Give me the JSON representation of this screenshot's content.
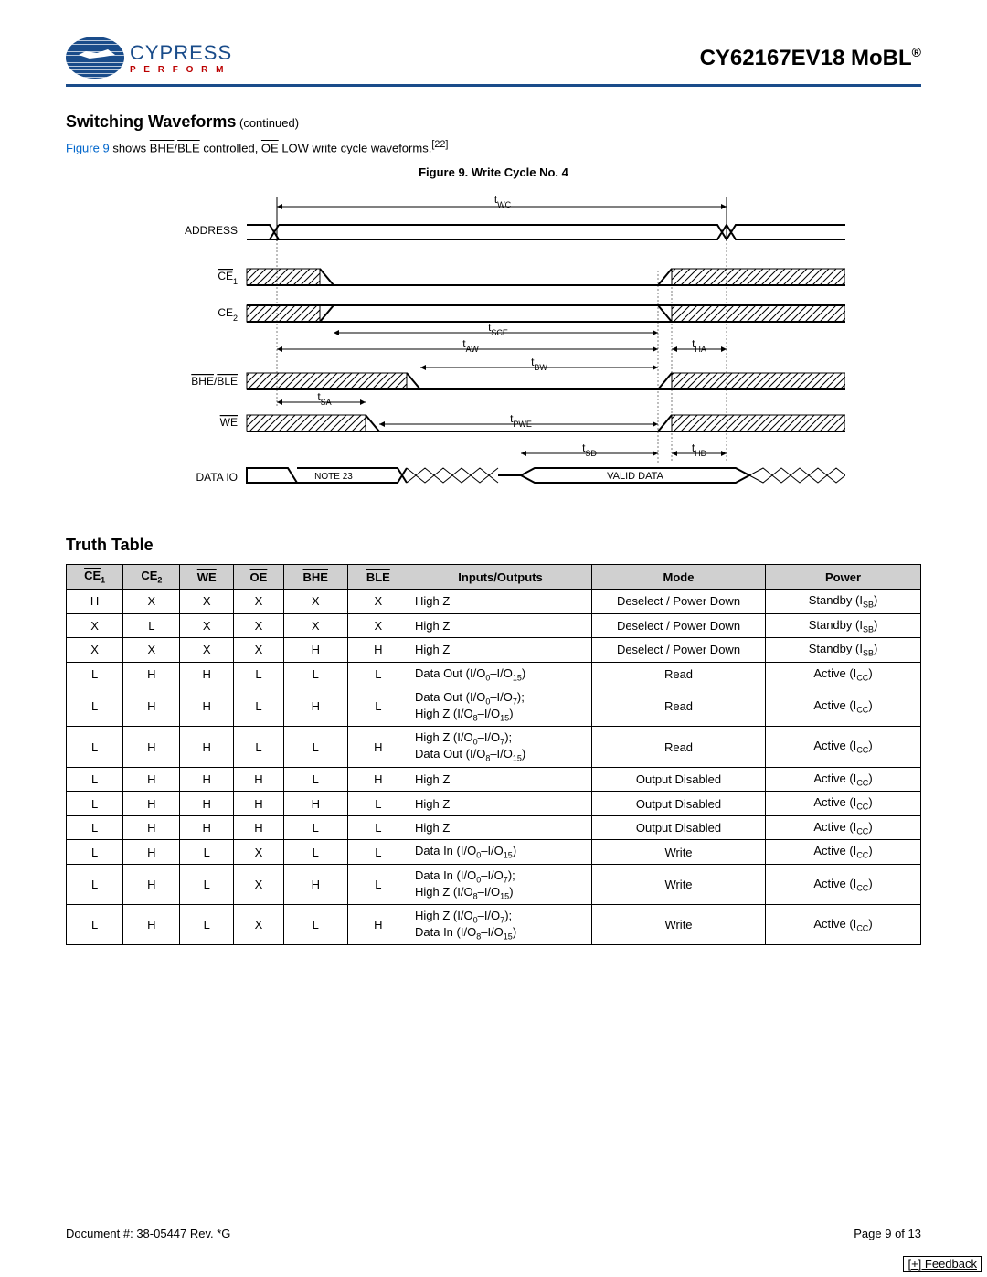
{
  "header": {
    "logo_name": "CYPRESS",
    "logo_perform": "P E R F O R M",
    "title": "CY62167EV18 MoBL",
    "title_sup": "®"
  },
  "section": {
    "heading": "Switching Waveforms",
    "continued": " (continued)",
    "intro_prefix": "Figure 9",
    "intro_rest_1": " shows ",
    "intro_bhe": "BHE",
    "intro_ble": "BLE",
    "intro_rest_2": " controlled, ",
    "intro_oe": "OE",
    "intro_rest_3": " LOW write cycle waveforms.",
    "intro_note": "[22]",
    "figure_caption": "Figure 9.  Write Cycle No. 4"
  },
  "waveform": {
    "signals": [
      "ADDRESS",
      "CE1",
      "CE2",
      "BHE/BLE",
      "WE",
      "DATA IO"
    ],
    "ce1_bar": true,
    "bhe_bar": true,
    "we_bar": true,
    "timing_labels": [
      "tWC",
      "tSCE",
      "tAW",
      "tHA",
      "tBW",
      "tSA",
      "tPWE",
      "tSD",
      "tHD"
    ],
    "note23": "NOTE 23",
    "valid_data": "VALID DATA"
  },
  "truth": {
    "title": "Truth Table",
    "headers": [
      "CE1",
      "CE2",
      "WE",
      "OE",
      "BHE",
      "BLE",
      "Inputs/Outputs",
      "Mode",
      "Power"
    ],
    "header_bars": [
      true,
      false,
      true,
      true,
      true,
      true,
      false,
      false,
      false
    ],
    "header_subs": [
      "1",
      "2",
      "",
      "",
      "",
      "",
      "",
      "",
      ""
    ],
    "rows": [
      {
        "cells": [
          "H",
          "X",
          "X",
          "X",
          "X",
          "X"
        ],
        "io": {
          "t": "High Z"
        },
        "mode": "Deselect / Power Down",
        "power": {
          "t": "Standby (I",
          "s": "SB",
          "e": ")"
        }
      },
      {
        "cells": [
          "X",
          "L",
          "X",
          "X",
          "X",
          "X"
        ],
        "io": {
          "t": "High Z"
        },
        "mode": "Deselect / Power Down",
        "power": {
          "t": "Standby (I",
          "s": "SB",
          "e": ")"
        }
      },
      {
        "cells": [
          "X",
          "X",
          "X",
          "X",
          "H",
          "H"
        ],
        "io": {
          "t": "High Z"
        },
        "mode": "Deselect / Power Down",
        "power": {
          "t": "Standby (I",
          "s": "SB",
          "e": ")"
        }
      },
      {
        "cells": [
          "L",
          "H",
          "H",
          "L",
          "L",
          "L"
        ],
        "io": {
          "t": "Data Out (I/O",
          "s1": "0",
          "m": "–I/O",
          "s2": "15",
          "e": ")"
        },
        "mode": "Read",
        "power": {
          "t": "Active (I",
          "s": "CC",
          "e": ")"
        }
      },
      {
        "cells": [
          "L",
          "H",
          "H",
          "L",
          "H",
          "L"
        ],
        "io": {
          "line1": {
            "t": "Data Out (I/O",
            "s1": "0",
            "m": "–I/O",
            "s2": "7",
            "e": ");"
          },
          "line2": {
            "t": "High Z (I/O",
            "s1": "8",
            "m": "–I/O",
            "s2": "15",
            "e": ")"
          }
        },
        "mode": "Read",
        "power": {
          "t": "Active (I",
          "s": "CC",
          "e": ")"
        }
      },
      {
        "cells": [
          "L",
          "H",
          "H",
          "L",
          "L",
          "H"
        ],
        "io": {
          "line1": {
            "t": "High Z (I/O",
            "s1": "0",
            "m": "–I/O",
            "s2": "7",
            "e": ");"
          },
          "line2": {
            "t": "Data Out (I/O",
            "s1": "8",
            "m": "–I/O",
            "s2": "15",
            "e": ")"
          }
        },
        "mode": "Read",
        "power": {
          "t": "Active (I",
          "s": "CC",
          "e": ")"
        }
      },
      {
        "cells": [
          "L",
          "H",
          "H",
          "H",
          "L",
          "H"
        ],
        "io": {
          "t": "High Z"
        },
        "mode": "Output Disabled",
        "power": {
          "t": "Active (I",
          "s": "CC",
          "e": ")"
        }
      },
      {
        "cells": [
          "L",
          "H",
          "H",
          "H",
          "H",
          "L"
        ],
        "io": {
          "t": "High Z"
        },
        "mode": "Output Disabled",
        "power": {
          "t": "Active (I",
          "s": "CC",
          "e": ")"
        }
      },
      {
        "cells": [
          "L",
          "H",
          "H",
          "H",
          "L",
          "L"
        ],
        "io": {
          "t": "High Z"
        },
        "mode": "Output Disabled",
        "power": {
          "t": "Active (I",
          "s": "CC",
          "e": ")"
        }
      },
      {
        "cells": [
          "L",
          "H",
          "L",
          "X",
          "L",
          "L"
        ],
        "io": {
          "t": "Data In (I/O",
          "s1": "0",
          "m": "–I/O",
          "s2": "15",
          "e": ")"
        },
        "mode": "Write",
        "power": {
          "t": "Active (I",
          "s": "CC",
          "e": ")"
        }
      },
      {
        "cells": [
          "L",
          "H",
          "L",
          "X",
          "H",
          "L"
        ],
        "io": {
          "line1": {
            "t": "Data In (I/O",
            "s1": "0",
            "m": "–I/O",
            "s2": "7",
            "e": ");"
          },
          "line2": {
            "t": "High Z (I/O",
            "s1": "8",
            "m": "–I/O",
            "s2": "15",
            "e": ")"
          }
        },
        "mode": "Write",
        "power": {
          "t": "Active (I",
          "s": "CC",
          "e": ")"
        }
      },
      {
        "cells": [
          "L",
          "H",
          "L",
          "X",
          "L",
          "H"
        ],
        "io": {
          "line1": {
            "t": "High Z (I/O",
            "s1": "0",
            "m": "–I/O",
            "s2": "7",
            "e": ");"
          },
          "line2": {
            "t": "Data In (I/O",
            "s1": "8",
            "m": "–I/O",
            "s2": "15",
            "e": ")"
          }
        },
        "mode": "Write",
        "power": {
          "t": "Active (I",
          "s": "CC",
          "e": ")"
        }
      }
    ]
  },
  "footer": {
    "doc": "Document #: 38-05447 Rev. *G",
    "page": "Page 9 of 13",
    "feedback": "[+] Feedback"
  }
}
